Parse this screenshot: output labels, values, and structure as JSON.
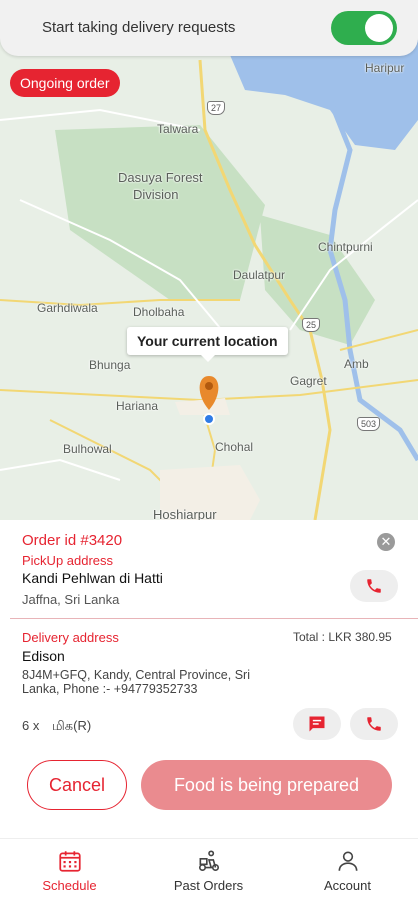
{
  "topbar": {
    "title": "Start taking delivery requests",
    "toggle_on": true
  },
  "badge": {
    "ongoing": "Ongoing order"
  },
  "map": {
    "callout": "Your current location",
    "labels": {
      "haripur": "Haripur",
      "talwara": "Talwara",
      "dasuya1": "Dasuya Forest",
      "dasuya2": "Division",
      "chintpurni": "Chintpurni",
      "daulatpur": "Daulatpur",
      "garhdiwala": "Garhdiwala",
      "dholbaha": "Dholbaha",
      "bhunga": "Bhunga",
      "gagret": "Gagret",
      "amb": "Amb",
      "hariana": "Hariana",
      "chohal": "Chohal",
      "bulhowal": "Bulhowal",
      "hoshiarpur": "Hoshiarpur"
    },
    "shields": {
      "r27": "27",
      "r25": "25",
      "r503": "503"
    }
  },
  "order": {
    "id": "Order id #3420",
    "pickup_label": "PickUp address",
    "pickup_name": "Kandi Pehlwan di Hatti",
    "pickup_location": "Jaffna, Sri Lanka",
    "delivery_label": "Delivery address",
    "total": "Total : LKR 380.95",
    "delivery_name": "Edison",
    "delivery_address": "8J4M+GFQ, Kandy, Central Province, Sri Lanka, Phone :- +94779352733",
    "item_qty": "6 x",
    "item_name": "மிக(R)"
  },
  "actions": {
    "cancel": "Cancel",
    "status": "Food is being prepared"
  },
  "nav": [
    {
      "label": "Schedule",
      "active": true
    },
    {
      "label": "Past Orders",
      "active": false
    },
    {
      "label": "Account",
      "active": false
    }
  ],
  "colors": {
    "accent": "#e62431",
    "toggle": "#2fae4e",
    "status_button": "#ea8b8f"
  }
}
